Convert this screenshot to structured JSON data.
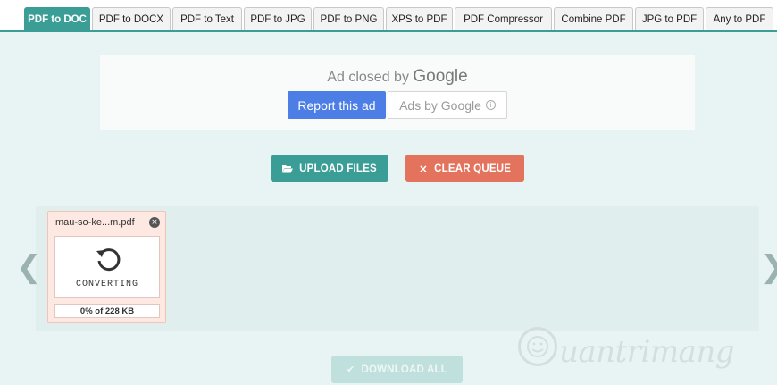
{
  "tabs": [
    {
      "label": "PDF to DOC",
      "active": true
    },
    {
      "label": "PDF to DOCX",
      "active": false
    },
    {
      "label": "PDF to Text",
      "active": false
    },
    {
      "label": "PDF to JPG",
      "active": false
    },
    {
      "label": "PDF to PNG",
      "active": false
    },
    {
      "label": "XPS to PDF",
      "active": false
    },
    {
      "label": "PDF Compressor",
      "active": false
    },
    {
      "label": "Combine PDF",
      "active": false
    },
    {
      "label": "JPG to PDF",
      "active": false
    },
    {
      "label": "Any to PDF",
      "active": false
    }
  ],
  "ad": {
    "closed_prefix": "Ad closed by",
    "closed_brand": "Google",
    "report_label": "Report this ad",
    "ads_by_label": "Ads by Google",
    "info_icon": "info-icon"
  },
  "actions": {
    "upload_label": "UPLOAD FILES",
    "upload_icon": "folder-open-icon",
    "clear_label": "CLEAR QUEUE",
    "clear_icon": "close-icon",
    "download_label": "DOWNLOAD ALL",
    "download_icon": "check-icon"
  },
  "queue": {
    "prev_glyph": "❮",
    "next_glyph": "❯",
    "files": [
      {
        "name": "mau-so-ke...m.pdf",
        "close_glyph": "×",
        "status": "CONVERTING",
        "progress_text": "0% of 228 KB",
        "progress_fraction": 0,
        "status_icon": "refresh-icon"
      }
    ]
  },
  "watermark": {
    "text": "uantrimang",
    "logo_icon": "quantrimang-logo-icon"
  },
  "colors": {
    "accent": "#3a9e96",
    "danger": "#e4735e",
    "ad_blue": "#4d7ee6",
    "background": "#e7f4f3"
  }
}
